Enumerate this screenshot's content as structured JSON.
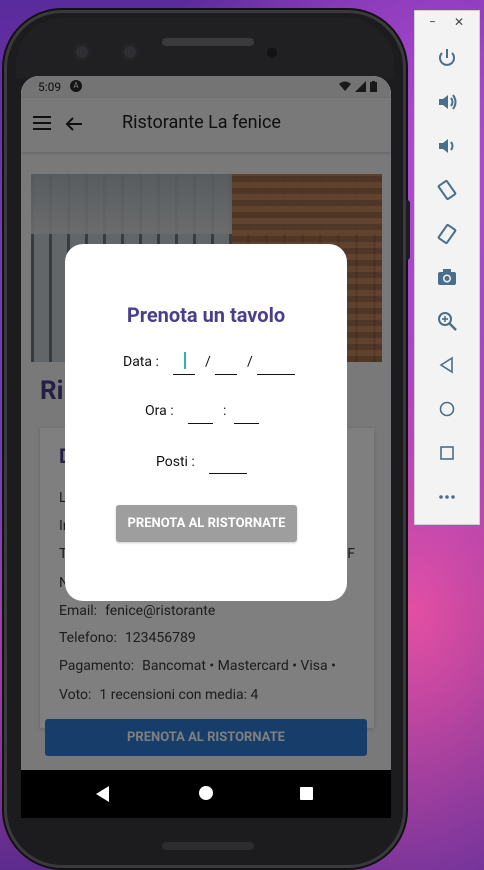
{
  "status_bar": {
    "time": "5:09",
    "notification_badge": "A"
  },
  "app_bar": {
    "title": "Ristorante La fenice"
  },
  "page": {
    "big_title": "Ri",
    "card_heading": "D",
    "rows": [
      {
        "key": "L",
        "value": ""
      },
      {
        "key": "In",
        "value": ""
      },
      {
        "key": "T",
        "value": "F"
      },
      {
        "key": "N",
        "value": ""
      },
      {
        "key": "Email:",
        "value": "fenice@ristorante"
      },
      {
        "key": "Telefono:",
        "value": "123456789"
      },
      {
        "key": "Pagamento:",
        "value": "Bancomat • Mastercard • Visa •"
      },
      {
        "key": "Voto:",
        "value": "1 recensioni con media: 4"
      }
    ],
    "bottom_button": "PRENOTA AL RISTORNATE"
  },
  "dialog": {
    "title": "Prenota un tavolo",
    "date_label": "Data :",
    "date_separator_1": "/",
    "date_separator_2": "/",
    "time_label": "Ora :",
    "time_separator": ":",
    "seats_label": "Posti :",
    "button": "PRENOTA AL RISTORNATE"
  },
  "emulator_toolbar": {
    "minimize": "−",
    "close": "✕",
    "icons": [
      "power-icon",
      "volume-up-icon",
      "volume-down-icon",
      "rotate-left-icon",
      "rotate-right-icon",
      "camera-icon",
      "zoom-icon",
      "back-icon",
      "home-icon",
      "overview-icon",
      "more-icon"
    ]
  },
  "colors": {
    "accent": "#4b3f8c",
    "primary_button": "#2f7cd4",
    "disabled_button": "#9e9e9e",
    "cursor": "#28b8b3"
  }
}
